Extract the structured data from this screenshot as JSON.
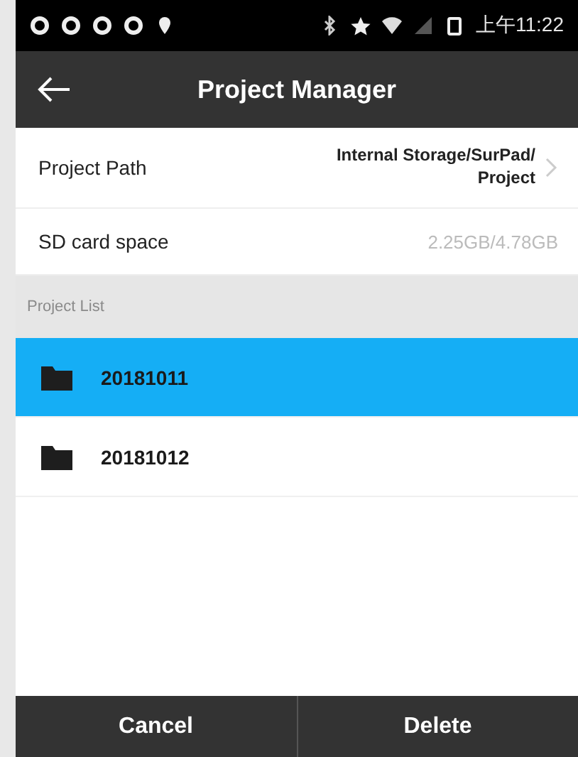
{
  "status_bar": {
    "time": "上午11:22"
  },
  "app_bar": {
    "title": "Project Manager"
  },
  "settings": [
    {
      "kind": "link",
      "label": "Project Path",
      "value": "Internal Storage/SurPad/ Project"
    },
    {
      "kind": "info",
      "label": "SD card space",
      "value": "2.25GB/4.78GB"
    }
  ],
  "project_list": {
    "header": "Project List",
    "items": [
      {
        "name": "20181011",
        "selected": true
      },
      {
        "name": "20181012",
        "selected": false
      }
    ]
  },
  "buttons": [
    {
      "label": "Cancel"
    },
    {
      "label": "Delete"
    }
  ]
}
